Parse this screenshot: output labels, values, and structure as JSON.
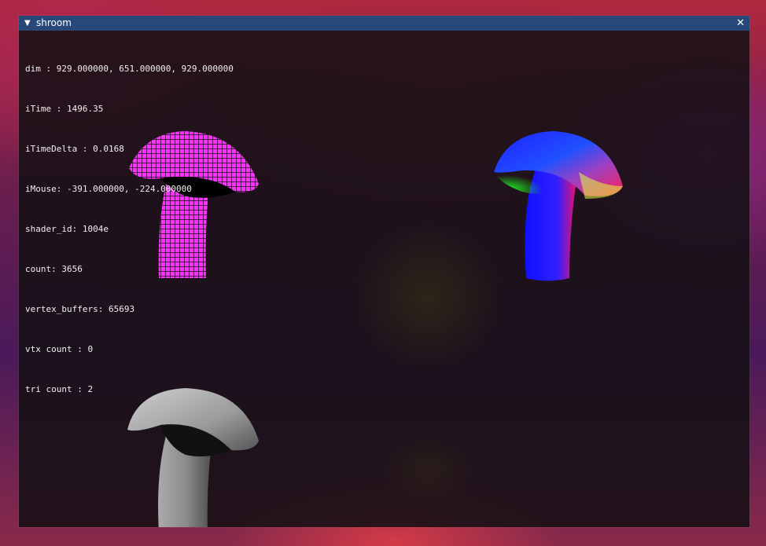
{
  "window": {
    "title": "shroom",
    "collapse_icon": "▼",
    "close_icon": "✕"
  },
  "stats": {
    "dim": "dim : 929.000000, 651.000000, 929.000000",
    "itime": "iTime : 1496.35",
    "itimedelta": "iTimeDelta : 0.0168",
    "imouse": "iMouse: -391.000000, -224.000000",
    "shader_id": "shader_id: 1004e",
    "count": "count: 3656",
    "vertex_buffers": "vertex_buffers: 65693",
    "vtx_count": "vtx count : 0",
    "tri_count": "tri count : 2"
  },
  "render_views": [
    "wireframe",
    "normals",
    "shaded"
  ],
  "colors": {
    "titlebar": "#29487a",
    "wireframe": "#ff00ff"
  }
}
